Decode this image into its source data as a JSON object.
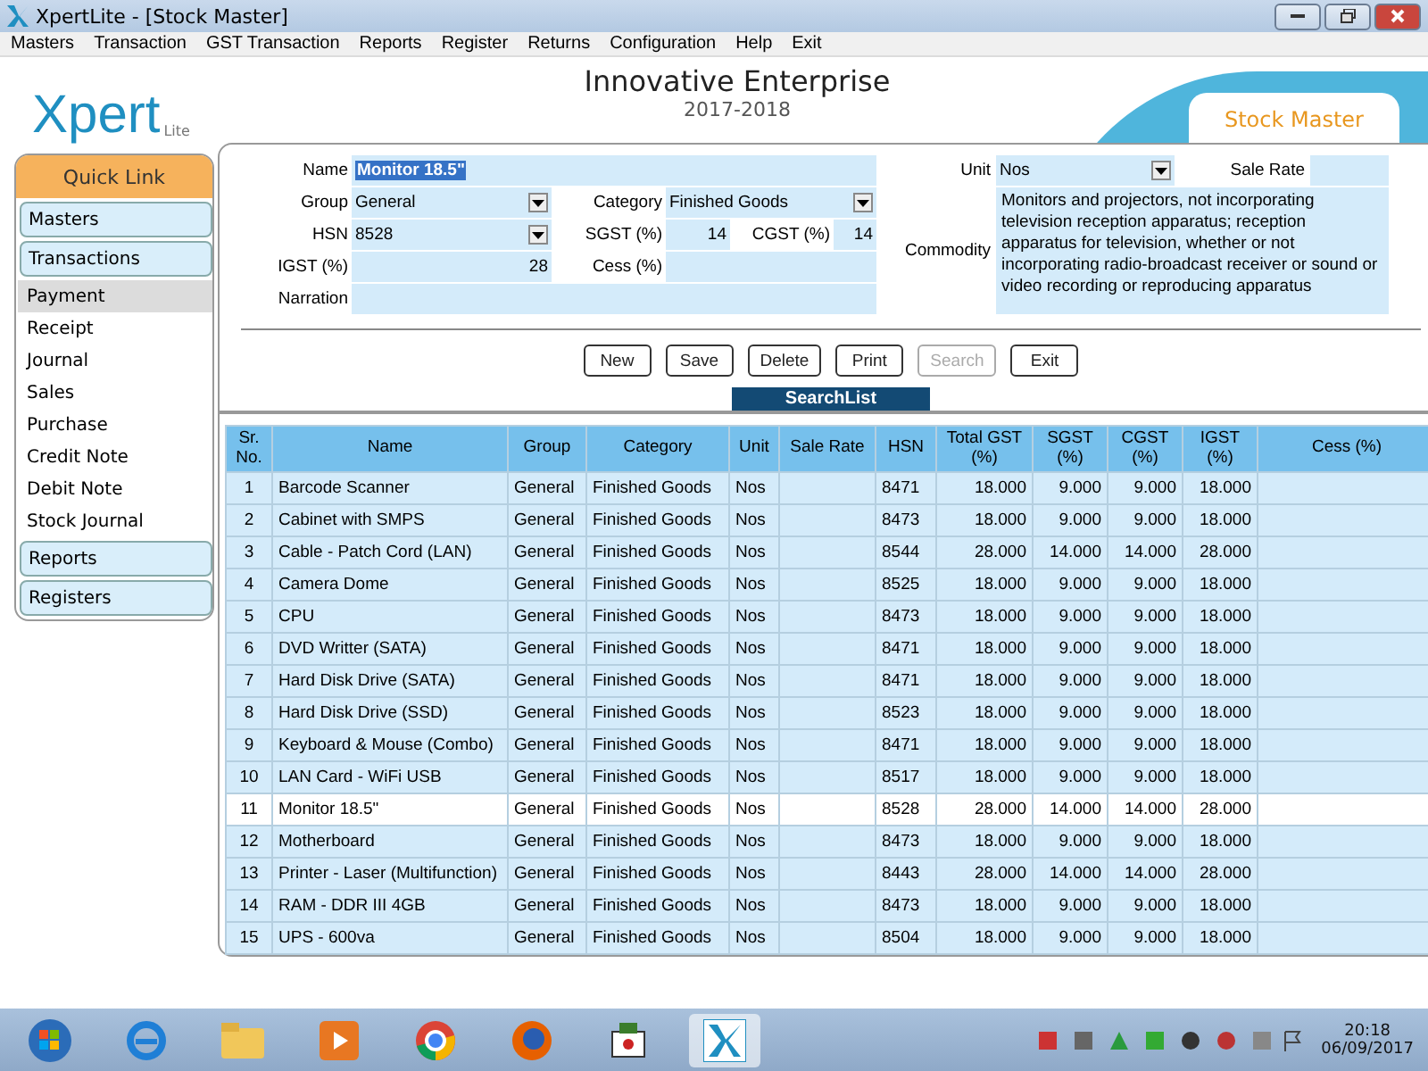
{
  "window": {
    "title": "XpertLite - [Stock Master]"
  },
  "menu": [
    "Masters",
    "Transaction",
    "GST Transaction",
    "Reports",
    "Register",
    "Returns",
    "Configuration",
    "Help",
    "Exit"
  ],
  "logo": {
    "text": "Xpert",
    "sub": "Lite"
  },
  "header": {
    "company": "Innovative Enterprise",
    "year": "2017-2018",
    "tab": "Stock Master"
  },
  "sidebar": {
    "title": "Quick Link",
    "sections": [
      {
        "label": "Masters"
      },
      {
        "label": "Transactions",
        "items": [
          {
            "label": "Payment",
            "selected": true
          },
          {
            "label": "Receipt",
            "selected": false
          },
          {
            "label": "Journal",
            "selected": false
          },
          {
            "label": "Sales",
            "selected": false
          },
          {
            "label": "Purchase",
            "selected": false
          },
          {
            "label": "Credit Note",
            "selected": false
          },
          {
            "label": "Debit Note",
            "selected": false
          },
          {
            "label": "Stock Journal",
            "selected": false
          }
        ]
      },
      {
        "label": "Reports"
      },
      {
        "label": "Registers"
      }
    ]
  },
  "form": {
    "name": {
      "label": "Name",
      "value": "Monitor 18.5\""
    },
    "group": {
      "label": "Group",
      "value": "General"
    },
    "category": {
      "label": "Category",
      "value": "Finished Goods"
    },
    "hsn": {
      "label": "HSN",
      "value": "8528"
    },
    "sgst": {
      "label": "SGST (%)",
      "value": "14"
    },
    "cgst": {
      "label": "CGST (%)",
      "value": "14"
    },
    "igst": {
      "label": "IGST (%)",
      "value": "28"
    },
    "cess": {
      "label": "Cess (%)"
    },
    "narration": {
      "label": "Narration"
    },
    "unit": {
      "label": "Unit",
      "value": "Nos"
    },
    "sale_rate": {
      "label": "Sale Rate"
    },
    "commodity": {
      "label": "Commodity",
      "value": "Monitors and projectors, not incorporating television reception apparatus; reception apparatus for television, whether or not incorporating radio-broadcast receiver or sound or video recording or reproducing apparatus"
    }
  },
  "buttons": [
    {
      "label": "New",
      "disabled": false
    },
    {
      "label": "Save",
      "disabled": false
    },
    {
      "label": "Delete",
      "disabled": false
    },
    {
      "label": "Print",
      "disabled": false
    },
    {
      "label": "Search",
      "disabled": true
    },
    {
      "label": "Exit",
      "disabled": false
    }
  ],
  "search_list": {
    "title": "SearchList",
    "columns": [
      "Sr. No.",
      "Name",
      "Group",
      "Category",
      "Unit",
      "Sale Rate",
      "HSN",
      "Total GST (%)",
      "SGST (%)",
      "CGST (%)",
      "IGST (%)",
      "Cess (%)"
    ],
    "rows": [
      {
        "cells": [
          "1",
          "Barcode Scanner",
          "General",
          "Finished Goods",
          "Nos",
          "",
          "8471",
          "18.000",
          "9.000",
          "9.000",
          "18.000",
          ""
        ],
        "selected": false
      },
      {
        "cells": [
          "2",
          "Cabinet with SMPS",
          "General",
          "Finished Goods",
          "Nos",
          "",
          "8473",
          "18.000",
          "9.000",
          "9.000",
          "18.000",
          ""
        ],
        "selected": false
      },
      {
        "cells": [
          "3",
          "Cable - Patch Cord (LAN)",
          "General",
          "Finished Goods",
          "Nos",
          "",
          "8544",
          "28.000",
          "14.000",
          "14.000",
          "28.000",
          ""
        ],
        "selected": false
      },
      {
        "cells": [
          "4",
          "Camera Dome",
          "General",
          "Finished Goods",
          "Nos",
          "",
          "8525",
          "18.000",
          "9.000",
          "9.000",
          "18.000",
          ""
        ],
        "selected": false
      },
      {
        "cells": [
          "5",
          "CPU",
          "General",
          "Finished Goods",
          "Nos",
          "",
          "8473",
          "18.000",
          "9.000",
          "9.000",
          "18.000",
          ""
        ],
        "selected": false
      },
      {
        "cells": [
          "6",
          "DVD Writter (SATA)",
          "General",
          "Finished Goods",
          "Nos",
          "",
          "8471",
          "18.000",
          "9.000",
          "9.000",
          "18.000",
          ""
        ],
        "selected": false
      },
      {
        "cells": [
          "7",
          "Hard Disk Drive (SATA)",
          "General",
          "Finished Goods",
          "Nos",
          "",
          "8471",
          "18.000",
          "9.000",
          "9.000",
          "18.000",
          ""
        ],
        "selected": false
      },
      {
        "cells": [
          "8",
          "Hard Disk Drive (SSD)",
          "General",
          "Finished Goods",
          "Nos",
          "",
          "8523",
          "18.000",
          "9.000",
          "9.000",
          "18.000",
          ""
        ],
        "selected": false
      },
      {
        "cells": [
          "9",
          "Keyboard & Mouse (Combo)",
          "General",
          "Finished Goods",
          "Nos",
          "",
          "8471",
          "18.000",
          "9.000",
          "9.000",
          "18.000",
          ""
        ],
        "selected": false
      },
      {
        "cells": [
          "10",
          "LAN Card - WiFi USB",
          "General",
          "Finished Goods",
          "Nos",
          "",
          "8517",
          "18.000",
          "9.000",
          "9.000",
          "18.000",
          ""
        ],
        "selected": false
      },
      {
        "cells": [
          "11",
          "Monitor 18.5\"",
          "General",
          "Finished Goods",
          "Nos",
          "",
          "8528",
          "28.000",
          "14.000",
          "14.000",
          "28.000",
          ""
        ],
        "selected": true
      },
      {
        "cells": [
          "12",
          "Motherboard",
          "General",
          "Finished Goods",
          "Nos",
          "",
          "8473",
          "18.000",
          "9.000",
          "9.000",
          "18.000",
          ""
        ],
        "selected": false
      },
      {
        "cells": [
          "13",
          "Printer - Laser (Multifunction)",
          "General",
          "Finished Goods",
          "Nos",
          "",
          "8443",
          "28.000",
          "14.000",
          "14.000",
          "28.000",
          ""
        ],
        "selected": false
      },
      {
        "cells": [
          "14",
          "RAM - DDR III 4GB",
          "General",
          "Finished Goods",
          "Nos",
          "",
          "8473",
          "18.000",
          "9.000",
          "9.000",
          "18.000",
          ""
        ],
        "selected": false
      },
      {
        "cells": [
          "15",
          "UPS - 600va",
          "General",
          "Finished Goods",
          "Nos",
          "",
          "8504",
          "18.000",
          "9.000",
          "9.000",
          "18.000",
          ""
        ],
        "selected": false
      }
    ]
  },
  "taskbar": {
    "time": "20:18",
    "date": "06/09/2017"
  }
}
